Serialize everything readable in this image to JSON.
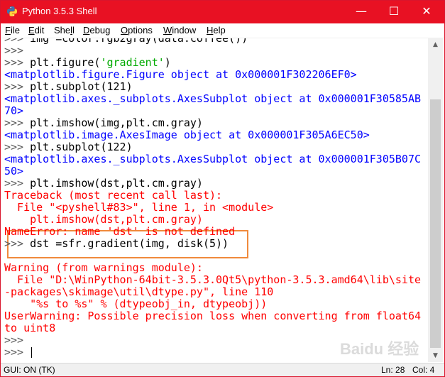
{
  "window": {
    "title": "Python 3.5.3 Shell",
    "title_bar_color": "#e81123",
    "controls": {
      "minimize_icon": "minimize-icon",
      "maximize_icon": "maximize-icon",
      "close_icon": "close-icon",
      "minimize_glyph": "—",
      "maximize_glyph": "☐",
      "close_glyph": "✕"
    }
  },
  "menu": {
    "items": [
      {
        "label": "File",
        "accel": "F",
        "rest": "ile"
      },
      {
        "label": "Edit",
        "accel": "E",
        "rest": "dit"
      },
      {
        "label": "Shell",
        "accel": "",
        "pre": "She",
        "mid": "l",
        "post": "l"
      },
      {
        "label": "Debug",
        "accel": "D",
        "rest": "ebug"
      },
      {
        "label": "Options",
        "accel": "O",
        "rest": "ptions"
      },
      {
        "label": "Window",
        "accel": "W",
        "rest": "indow"
      },
      {
        "label": "Help",
        "accel": "H",
        "rest": "elp"
      }
    ]
  },
  "shell": {
    "lines": [
      {
        "parts": [
          {
            "t": ">>> ",
            "c": "prompt"
          },
          {
            "t": "img =color.rgb2gray(data.coffee())",
            "c": "input"
          }
        ]
      },
      {
        "parts": [
          {
            "t": ">>>",
            "c": "prompt"
          }
        ]
      },
      {
        "parts": [
          {
            "t": ">>> ",
            "c": "prompt"
          },
          {
            "t": "plt.figure(",
            "c": "input"
          },
          {
            "t": "'gradient'",
            "c": "string"
          },
          {
            "t": ")",
            "c": "input"
          }
        ]
      },
      {
        "parts": [
          {
            "t": "<matplotlib.figure.Figure object at 0x000001F302206EF0>",
            "c": "output"
          }
        ]
      },
      {
        "parts": [
          {
            "t": ">>> ",
            "c": "prompt"
          },
          {
            "t": "plt.subplot(121)",
            "c": "input"
          }
        ]
      },
      {
        "parts": [
          {
            "t": "<matplotlib.axes._subplots.AxesSubplot object at 0x000001F30585AB",
            "c": "output"
          }
        ]
      },
      {
        "parts": [
          {
            "t": "70>",
            "c": "output"
          }
        ]
      },
      {
        "parts": [
          {
            "t": ">>> ",
            "c": "prompt"
          },
          {
            "t": "plt.imshow(img,plt.cm.gray)",
            "c": "input"
          }
        ]
      },
      {
        "parts": [
          {
            "t": "<matplotlib.image.AxesImage object at 0x000001F305A6EC50>",
            "c": "output"
          }
        ]
      },
      {
        "parts": [
          {
            "t": ">>> ",
            "c": "prompt"
          },
          {
            "t": "plt.subplot(122)",
            "c": "input"
          }
        ]
      },
      {
        "parts": [
          {
            "t": "<matplotlib.axes._subplots.AxesSubplot object at 0x000001F305B07C",
            "c": "output"
          }
        ]
      },
      {
        "parts": [
          {
            "t": "50>",
            "c": "output"
          }
        ]
      },
      {
        "parts": [
          {
            "t": ">>> ",
            "c": "prompt"
          },
          {
            "t": "plt.imshow(dst,plt.cm.gray)",
            "c": "input"
          }
        ]
      },
      {
        "parts": [
          {
            "t": "Traceback (most recent call last):",
            "c": "error"
          }
        ]
      },
      {
        "parts": [
          {
            "t": "  File \"<pyshell#83>\", line 1, in <module>",
            "c": "error"
          }
        ]
      },
      {
        "parts": [
          {
            "t": "    plt.imshow(dst,plt.cm.gray)",
            "c": "error"
          }
        ]
      },
      {
        "parts": [
          {
            "t": "NameError: name 'dst' is not defined",
            "c": "error"
          }
        ]
      },
      {
        "parts": [
          {
            "t": ">>> ",
            "c": "prompt"
          },
          {
            "t": "dst =sfr.gradient(img, disk(5))",
            "c": "input"
          }
        ]
      },
      {
        "parts": [
          {
            "t": "",
            "c": "input"
          }
        ]
      },
      {
        "parts": [
          {
            "t": "Warning (from warnings module):",
            "c": "error"
          }
        ]
      },
      {
        "parts": [
          {
            "t": "  File \"D:\\WinPython-64bit-3.5.3.0Qt5\\python-3.5.3.amd64\\lib\\site",
            "c": "error"
          }
        ]
      },
      {
        "parts": [
          {
            "t": "-packages\\skimage\\util\\dtype.py\", line 110",
            "c": "error"
          }
        ]
      },
      {
        "parts": [
          {
            "t": "    \"%s to %s\" % (dtypeobj_in, dtypeobj))",
            "c": "error"
          }
        ]
      },
      {
        "parts": [
          {
            "t": "UserWarning: Possible precision loss when converting from float64",
            "c": "error"
          }
        ]
      },
      {
        "parts": [
          {
            "t": "to uint8",
            "c": "error"
          }
        ]
      },
      {
        "parts": [
          {
            "t": ">>>",
            "c": "prompt"
          }
        ]
      },
      {
        "parts": [
          {
            "t": ">>> ",
            "c": "prompt"
          }
        ]
      }
    ]
  },
  "status": {
    "left": "GUI: ON (TK)",
    "line": "Ln: 28",
    "col": "Col: 4"
  },
  "watermark": {
    "text": "Baidu 经验"
  },
  "colors": {
    "prompt": "#5b5b5b",
    "input": "#000000",
    "string": "#00aa00",
    "output": "#0000ff",
    "error": "#ff0000",
    "highlight_border": "#f08a3c"
  }
}
